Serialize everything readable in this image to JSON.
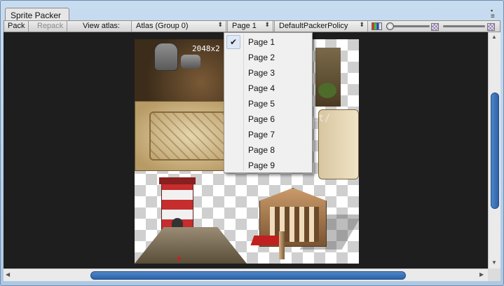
{
  "window": {
    "title": "Sprite Packer"
  },
  "toolbar": {
    "pack_label": "Pack",
    "repack_label": "Repack",
    "view_atlas_label": "View atlas:",
    "atlas_selected": "Atlas (Group 0)",
    "page_selected": "Page 1",
    "policy_selected": "DefaultPackerPolicy"
  },
  "atlas_view": {
    "size_label": "2048x2"
  },
  "page_menu": {
    "checked_index": 0,
    "items": [
      "Page 1",
      "Page 2",
      "Page 3",
      "Page 4",
      "Page 5",
      "Page 6",
      "Page 7",
      "Page 8",
      "Page 9"
    ]
  },
  "watermark": "//blog.csdn.net/",
  "icons": {
    "check": "check-icon",
    "dropdown": "chevron-down-icon",
    "color_mode": "rgb-color-icon",
    "checker": "checkerboard-icon"
  }
}
